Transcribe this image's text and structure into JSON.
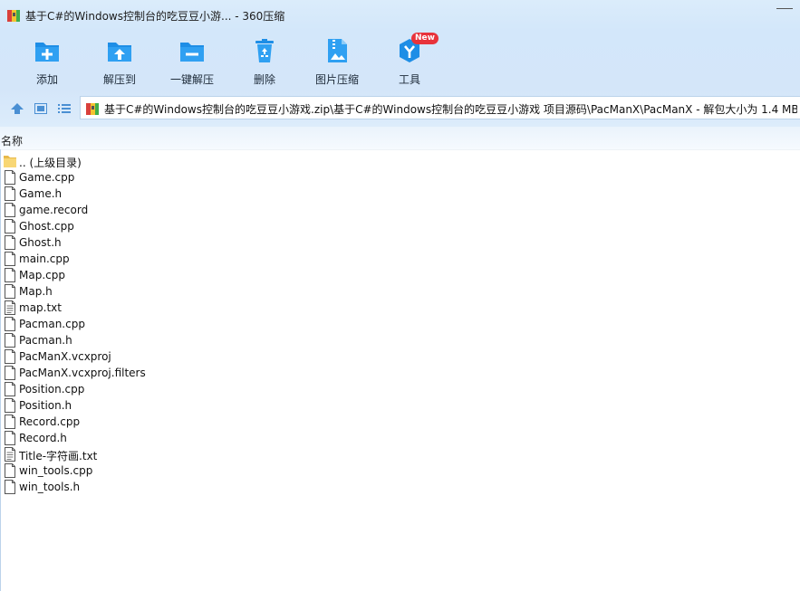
{
  "window": {
    "title": "基于C#的Windows控制台的吃豆豆小游... - 360压缩"
  },
  "toolbar": {
    "buttons": [
      {
        "label": "添加",
        "icon": "add-folder-icon"
      },
      {
        "label": "解压到",
        "icon": "extract-to-icon"
      },
      {
        "label": "一键解压",
        "icon": "one-click-extract-icon"
      },
      {
        "label": "删除",
        "icon": "recycle-bin-icon"
      },
      {
        "label": "图片压缩",
        "icon": "image-compress-icon"
      },
      {
        "label": "工具",
        "icon": "tools-icon",
        "badge": "New"
      }
    ]
  },
  "address": {
    "path": "基于C#的Windows控制台的吃豆豆小游戏.zip\\基于C#的Windows控制台的吃豆豆小游戏 项目源码\\PacManX\\PacManX - 解包大小为 1.4 MB"
  },
  "columns": {
    "name": "名称"
  },
  "files": [
    {
      "name": ".. (上级目录)",
      "type": "folder"
    },
    {
      "name": "Game.cpp",
      "type": "file"
    },
    {
      "name": "Game.h",
      "type": "file"
    },
    {
      "name": "game.record",
      "type": "file"
    },
    {
      "name": "Ghost.cpp",
      "type": "file"
    },
    {
      "name": "Ghost.h",
      "type": "file"
    },
    {
      "name": "main.cpp",
      "type": "file"
    },
    {
      "name": "Map.cpp",
      "type": "file"
    },
    {
      "name": "Map.h",
      "type": "file"
    },
    {
      "name": "map.txt",
      "type": "text"
    },
    {
      "name": "Pacman.cpp",
      "type": "file"
    },
    {
      "name": "Pacman.h",
      "type": "file"
    },
    {
      "name": "PacManX.vcxproj",
      "type": "file"
    },
    {
      "name": "PacManX.vcxproj.filters",
      "type": "file"
    },
    {
      "name": "Position.cpp",
      "type": "file"
    },
    {
      "name": "Position.h",
      "type": "file"
    },
    {
      "name": "Record.cpp",
      "type": "file"
    },
    {
      "name": "Record.h",
      "type": "file"
    },
    {
      "name": "Title-字符画.txt",
      "type": "text"
    },
    {
      "name": "win_tools.cpp",
      "type": "file"
    },
    {
      "name": "win_tools.h",
      "type": "file"
    }
  ],
  "colors": {
    "accent": "#1e8ee6",
    "badge": "#e8333b",
    "folder": "#f8d775"
  }
}
